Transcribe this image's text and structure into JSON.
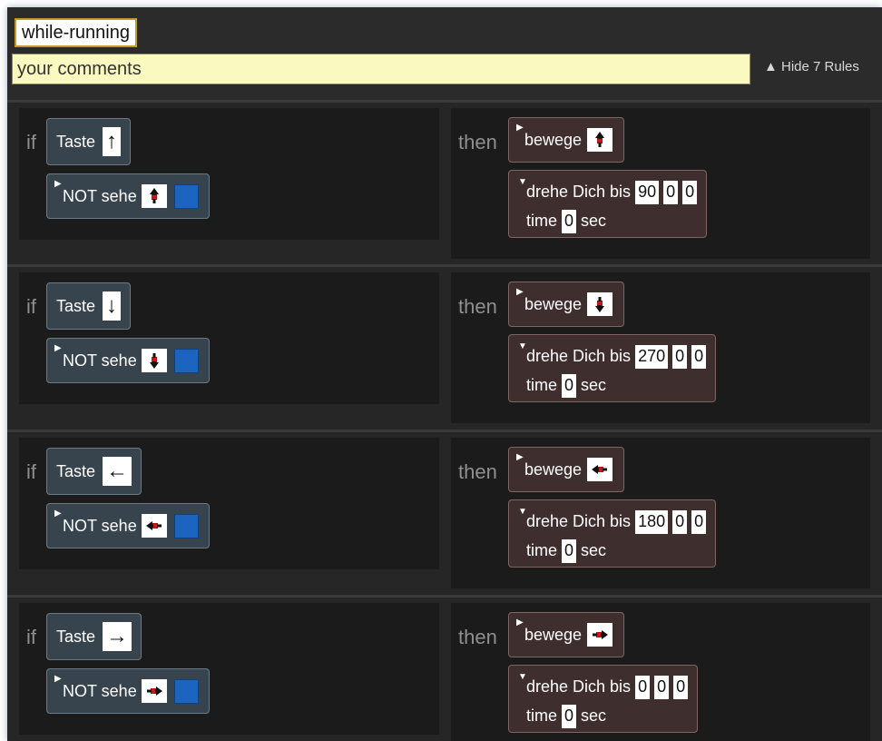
{
  "header": {
    "rule_name": "while-running",
    "comments_placeholder": "your comments",
    "hide_rules": "▲ Hide 7 Rules"
  },
  "rules": [
    {
      "if_label": "if",
      "taste_label": "Taste",
      "key": "↑",
      "not_label": "NOT sehe",
      "not_arrow_icon": "arrow-up-icon",
      "then_label": "then",
      "bewege_label": "bewege",
      "bewege_arrow_icon": "arrow-up-icon",
      "drehe_label": "drehe Dich bis",
      "angles": [
        "90",
        "0",
        "0"
      ],
      "time_label": "time",
      "time_value": "0",
      "sec_label": "sec"
    },
    {
      "if_label": "if",
      "taste_label": "Taste",
      "key": "↓",
      "not_label": "NOT sehe",
      "not_arrow_icon": "arrow-down-icon",
      "then_label": "then",
      "bewege_label": "bewege",
      "bewege_arrow_icon": "arrow-down-icon",
      "drehe_label": "drehe Dich bis",
      "angles": [
        "270",
        "0",
        "0"
      ],
      "time_label": "time",
      "time_value": "0",
      "sec_label": "sec"
    },
    {
      "if_label": "if",
      "taste_label": "Taste",
      "key": "←",
      "not_label": "NOT sehe",
      "not_arrow_icon": "arrow-left-icon",
      "then_label": "then",
      "bewege_label": "bewege",
      "bewege_arrow_icon": "arrow-left-icon",
      "drehe_label": "drehe Dich bis",
      "angles": [
        "180",
        "0",
        "0"
      ],
      "time_label": "time",
      "time_value": "0",
      "sec_label": "sec"
    },
    {
      "if_label": "if",
      "taste_label": "Taste",
      "key": "→",
      "not_label": "NOT sehe",
      "not_arrow_icon": "arrow-right-icon",
      "then_label": "then",
      "bewege_label": "bewege",
      "bewege_arrow_icon": "arrow-right-icon",
      "drehe_label": "drehe Dich bis",
      "angles": [
        "0",
        "0",
        "0"
      ],
      "time_label": "time",
      "time_value": "0",
      "sec_label": "sec"
    }
  ],
  "colors": {
    "background": "#262626",
    "block_blue": "#37444d",
    "block_brown": "#3e2e2d",
    "color_square": "#1b64c0",
    "comments_bg": "#fafac0",
    "name_border": "#c49a28"
  }
}
